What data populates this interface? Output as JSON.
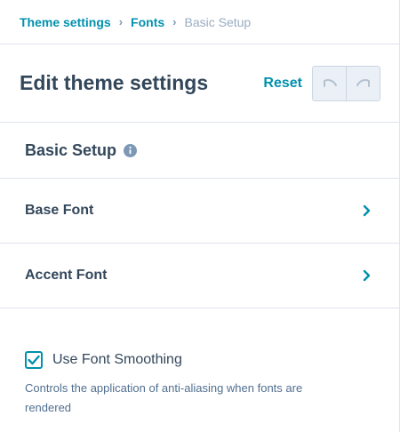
{
  "breadcrumb": {
    "items": [
      "Theme settings",
      "Fonts"
    ],
    "current": "Basic Setup",
    "separator": "›"
  },
  "header": {
    "title": "Edit theme settings",
    "reset_label": "Reset",
    "undo_icon": "undo-icon",
    "redo_icon": "redo-icon"
  },
  "section": {
    "title": "Basic Setup",
    "info_icon": "info-icon"
  },
  "rows": [
    {
      "label": "Base Font",
      "icon": "chevron-right-icon"
    },
    {
      "label": "Accent Font",
      "icon": "chevron-right-icon"
    }
  ],
  "option": {
    "label": "Use Font Smoothing",
    "checked": true,
    "help": "Controls the application of anti-aliasing when fonts are rendered"
  },
  "colors": {
    "accent": "#0091ae",
    "text": "#33475b",
    "muted": "#99acc2",
    "border": "#dfe3eb"
  }
}
